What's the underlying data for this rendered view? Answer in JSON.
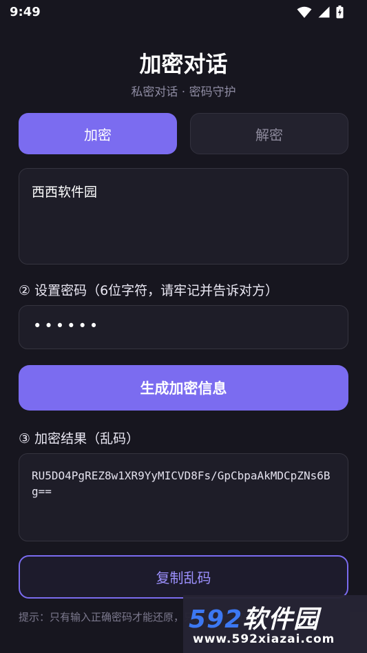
{
  "status_bar": {
    "time": "9:49"
  },
  "header": {
    "title": "加密对话",
    "subtitle": "私密对话 · 密码守护"
  },
  "tabs": [
    {
      "label": "加密",
      "active": true
    },
    {
      "label": "解密",
      "active": false
    }
  ],
  "message_input": {
    "value": "西西软件园"
  },
  "password": {
    "label": "② 设置密码（6位字符，请牢记并告诉对方）",
    "value": "••••••"
  },
  "generate_button": {
    "label": "生成加密信息"
  },
  "result": {
    "label": "③ 加密结果（乱码）",
    "value": "RU5DO4PgREZ8w1XR9YyMICVD8Fs/GpCbpaAkMDCpZNs6Bg=="
  },
  "copy_button": {
    "label": "复制乱码"
  },
  "hint": {
    "text": "提示：只有输入正确密码才能还原，只会显示一句优美散文。"
  },
  "watermark": {
    "logo_number": "592",
    "logo_text": "软件园",
    "url": "www.592xiazai.com"
  },
  "colors": {
    "accent": "#7b6cf0",
    "background": "#17161f",
    "field": "#1e1d28"
  }
}
